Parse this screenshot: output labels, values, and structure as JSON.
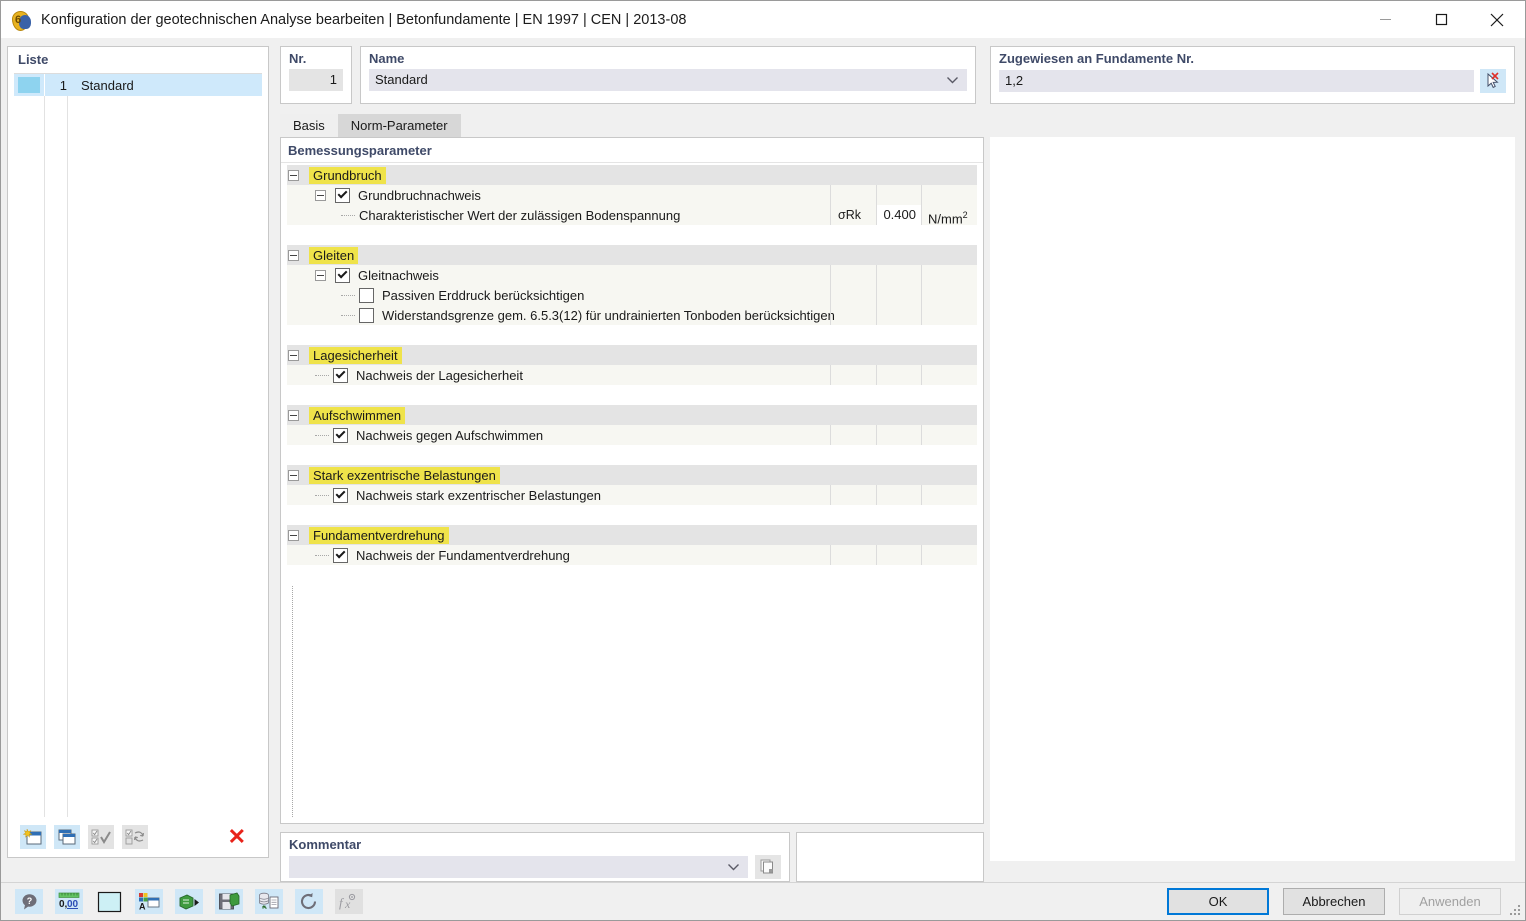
{
  "window": {
    "title": "Konfiguration der geotechnischen Analyse bearbeiten | Betonfundamente | EN 1997 | CEN | 2013-08",
    "app_icon": "rfem-6-icon",
    "minimize": "minimize-icon",
    "maximize": "maximize-icon",
    "close": "close-icon"
  },
  "list_panel": {
    "label": "Liste",
    "rows": [
      {
        "no": "1",
        "name": "Standard",
        "color": "#8ed3ef"
      }
    ],
    "toolbar": [
      {
        "name": "new-configuration-button",
        "icon": "new-window-star-icon",
        "enabled": true
      },
      {
        "name": "copy-configuration-button",
        "icon": "copy-window-icon",
        "enabled": true
      },
      {
        "name": "select-all-button",
        "icon": "check-all-icon",
        "enabled": false
      },
      {
        "name": "invert-selection-button",
        "icon": "invert-selection-icon",
        "enabled": false
      },
      {
        "name": "delete-configuration-button",
        "icon": "red-x-icon",
        "enabled": true
      }
    ]
  },
  "header": {
    "nr_label": "Nr.",
    "nr_value": "1",
    "name_label": "Name",
    "name_value": "Standard",
    "name_dropdown_icon": "chevron-down-icon",
    "assigned_label": "Zugewiesen an Fundamente Nr.",
    "assigned_value": "1,2",
    "assigned_pick_icon": "select-objects-cursor-icon"
  },
  "tabs": [
    {
      "label": "Basis",
      "active": true
    },
    {
      "label": "Norm-Parameter",
      "active": false
    }
  ],
  "tree": {
    "title": "Bemessungsparameter",
    "groups": [
      {
        "name": "Grundbruch",
        "expanded": true,
        "rows": [
          {
            "kind": "node",
            "indent": 1,
            "expander": true,
            "checkbox": "checked",
            "label": "Grundbruchnachweis",
            "symbol": "",
            "value": "",
            "unit": "",
            "value_editable": false
          },
          {
            "kind": "leaf",
            "indent": 2,
            "expander": false,
            "checkbox": "none",
            "label": "Charakteristischer Wert der zulässigen Bodenspannung",
            "symbol": "σRk",
            "value": "0.400",
            "unit": "N/mm²",
            "unit_base": "N/mm",
            "unit_sup": "2",
            "value_editable": true
          }
        ]
      },
      {
        "name": "Gleiten",
        "expanded": true,
        "rows": [
          {
            "kind": "node",
            "indent": 1,
            "expander": true,
            "checkbox": "checked",
            "label": "Gleitnachweis",
            "symbol": "",
            "value": "",
            "unit": "",
            "value_editable": false
          },
          {
            "kind": "leaf",
            "indent": 2,
            "expander": false,
            "checkbox": "unchecked",
            "label": "Passiven Erddruck berücksichtigen",
            "symbol": "",
            "value": "",
            "unit": "",
            "value_editable": false
          },
          {
            "kind": "leaf",
            "indent": 2,
            "expander": false,
            "checkbox": "unchecked",
            "label": "Widerstandsgrenze gem. 6.5.3(12) für undrainierten Tonboden berücksichtigen",
            "symbol": "",
            "value": "",
            "unit": "",
            "value_editable": false
          }
        ]
      },
      {
        "name": "Lagesicherheit",
        "expanded": true,
        "rows": [
          {
            "kind": "leaf",
            "indent": 1,
            "expander": false,
            "checkbox": "checked",
            "label": "Nachweis der Lagesicherheit",
            "symbol": "",
            "value": "",
            "unit": "",
            "value_editable": false
          }
        ]
      },
      {
        "name": "Aufschwimmen",
        "expanded": true,
        "rows": [
          {
            "kind": "leaf",
            "indent": 1,
            "expander": false,
            "checkbox": "checked",
            "label": "Nachweis gegen Aufschwimmen",
            "symbol": "",
            "value": "",
            "unit": "",
            "value_editable": false
          }
        ]
      },
      {
        "name": "Stark exzentrische Belastungen",
        "expanded": true,
        "rows": [
          {
            "kind": "leaf",
            "indent": 1,
            "expander": false,
            "checkbox": "checked",
            "label": "Nachweis stark exzentrischer Belastungen",
            "symbol": "",
            "value": "",
            "unit": "",
            "value_editable": false
          }
        ]
      },
      {
        "name": "Fundamentverdrehung",
        "expanded": true,
        "rows": [
          {
            "kind": "leaf",
            "indent": 1,
            "expander": false,
            "checkbox": "checked",
            "label": "Nachweis der Fundamentverdrehung",
            "symbol": "",
            "value": "",
            "unit": "",
            "value_editable": false
          }
        ]
      }
    ]
  },
  "comment": {
    "label": "Kommentar",
    "value": "",
    "dropdown_icon": "chevron-down-icon",
    "copy_icon": "copy-pages-icon"
  },
  "status_toolbar": [
    {
      "name": "help-button",
      "icon": "help-balloon-icon",
      "enabled": true
    },
    {
      "name": "units-button",
      "icon": "units-decimal-icon",
      "enabled": true
    },
    {
      "name": "color-button",
      "icon": "color-swatch-icon",
      "enabled": true
    },
    {
      "name": "display-properties-button",
      "icon": "display-properties-icon",
      "enabled": true
    },
    {
      "name": "import-button",
      "icon": "import-arrow-icon",
      "enabled": true
    },
    {
      "name": "save-as-button",
      "icon": "save-disk-icon",
      "enabled": true
    },
    {
      "name": "export-details-button",
      "icon": "export-document-icon",
      "enabled": true
    },
    {
      "name": "reset-button",
      "icon": "undo-circular-icon",
      "enabled": true
    },
    {
      "name": "formula-button",
      "icon": "fx-formula-icon",
      "enabled": false
    }
  ],
  "dialog_buttons": [
    {
      "label": "OK",
      "name": "ok-button",
      "style": "default",
      "enabled": true
    },
    {
      "label": "Abbrechen",
      "name": "cancel-button",
      "style": "normal",
      "enabled": true
    },
    {
      "label": "Anwenden",
      "name": "apply-button",
      "style": "disabled",
      "enabled": false
    }
  ],
  "colors": {
    "highlight_yellow": "#efe34a",
    "accent_blue": "#0078d7",
    "label_blue": "#3f4a68",
    "selection_blue": "#cfe9fb",
    "field_lavender": "#e4e4ec"
  }
}
